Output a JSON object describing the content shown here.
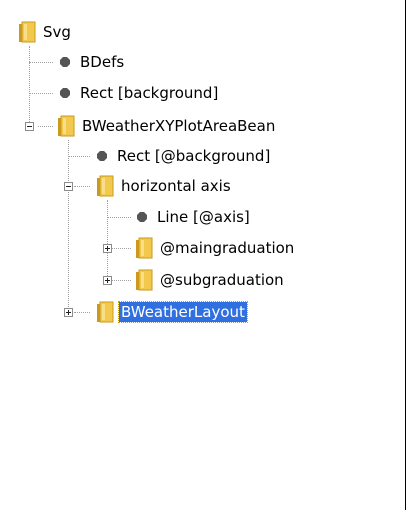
{
  "tree": {
    "nodes": [
      {
        "label": "Svg",
        "icon": "folder-icon",
        "expander": "none"
      },
      {
        "label": "BDefs",
        "icon": "bullet-icon"
      },
      {
        "label": "Rect [background]",
        "icon": "bullet-icon"
      },
      {
        "label": "BWeatherXYPlotAreaBean",
        "icon": "folder-icon",
        "expander": "minus"
      },
      {
        "label": "Rect [@background]",
        "icon": "bullet-icon"
      },
      {
        "label": "horizontal axis",
        "icon": "folder-icon",
        "expander": "minus"
      },
      {
        "label": "Line [@axis]",
        "icon": "bullet-icon"
      },
      {
        "label": "@maingraduation",
        "icon": "folder-icon",
        "expander": "plus"
      },
      {
        "label": "@subgraduation",
        "icon": "folder-icon",
        "expander": "plus"
      },
      {
        "label": "BWeatherLayout",
        "icon": "folder-icon",
        "expander": "plus",
        "selected": true
      }
    ]
  },
  "colors": {
    "selection_bg": "#2f6fe0",
    "folder_body": "#f2c94c",
    "folder_edge": "#c99a1e",
    "bullet": "#555555"
  }
}
